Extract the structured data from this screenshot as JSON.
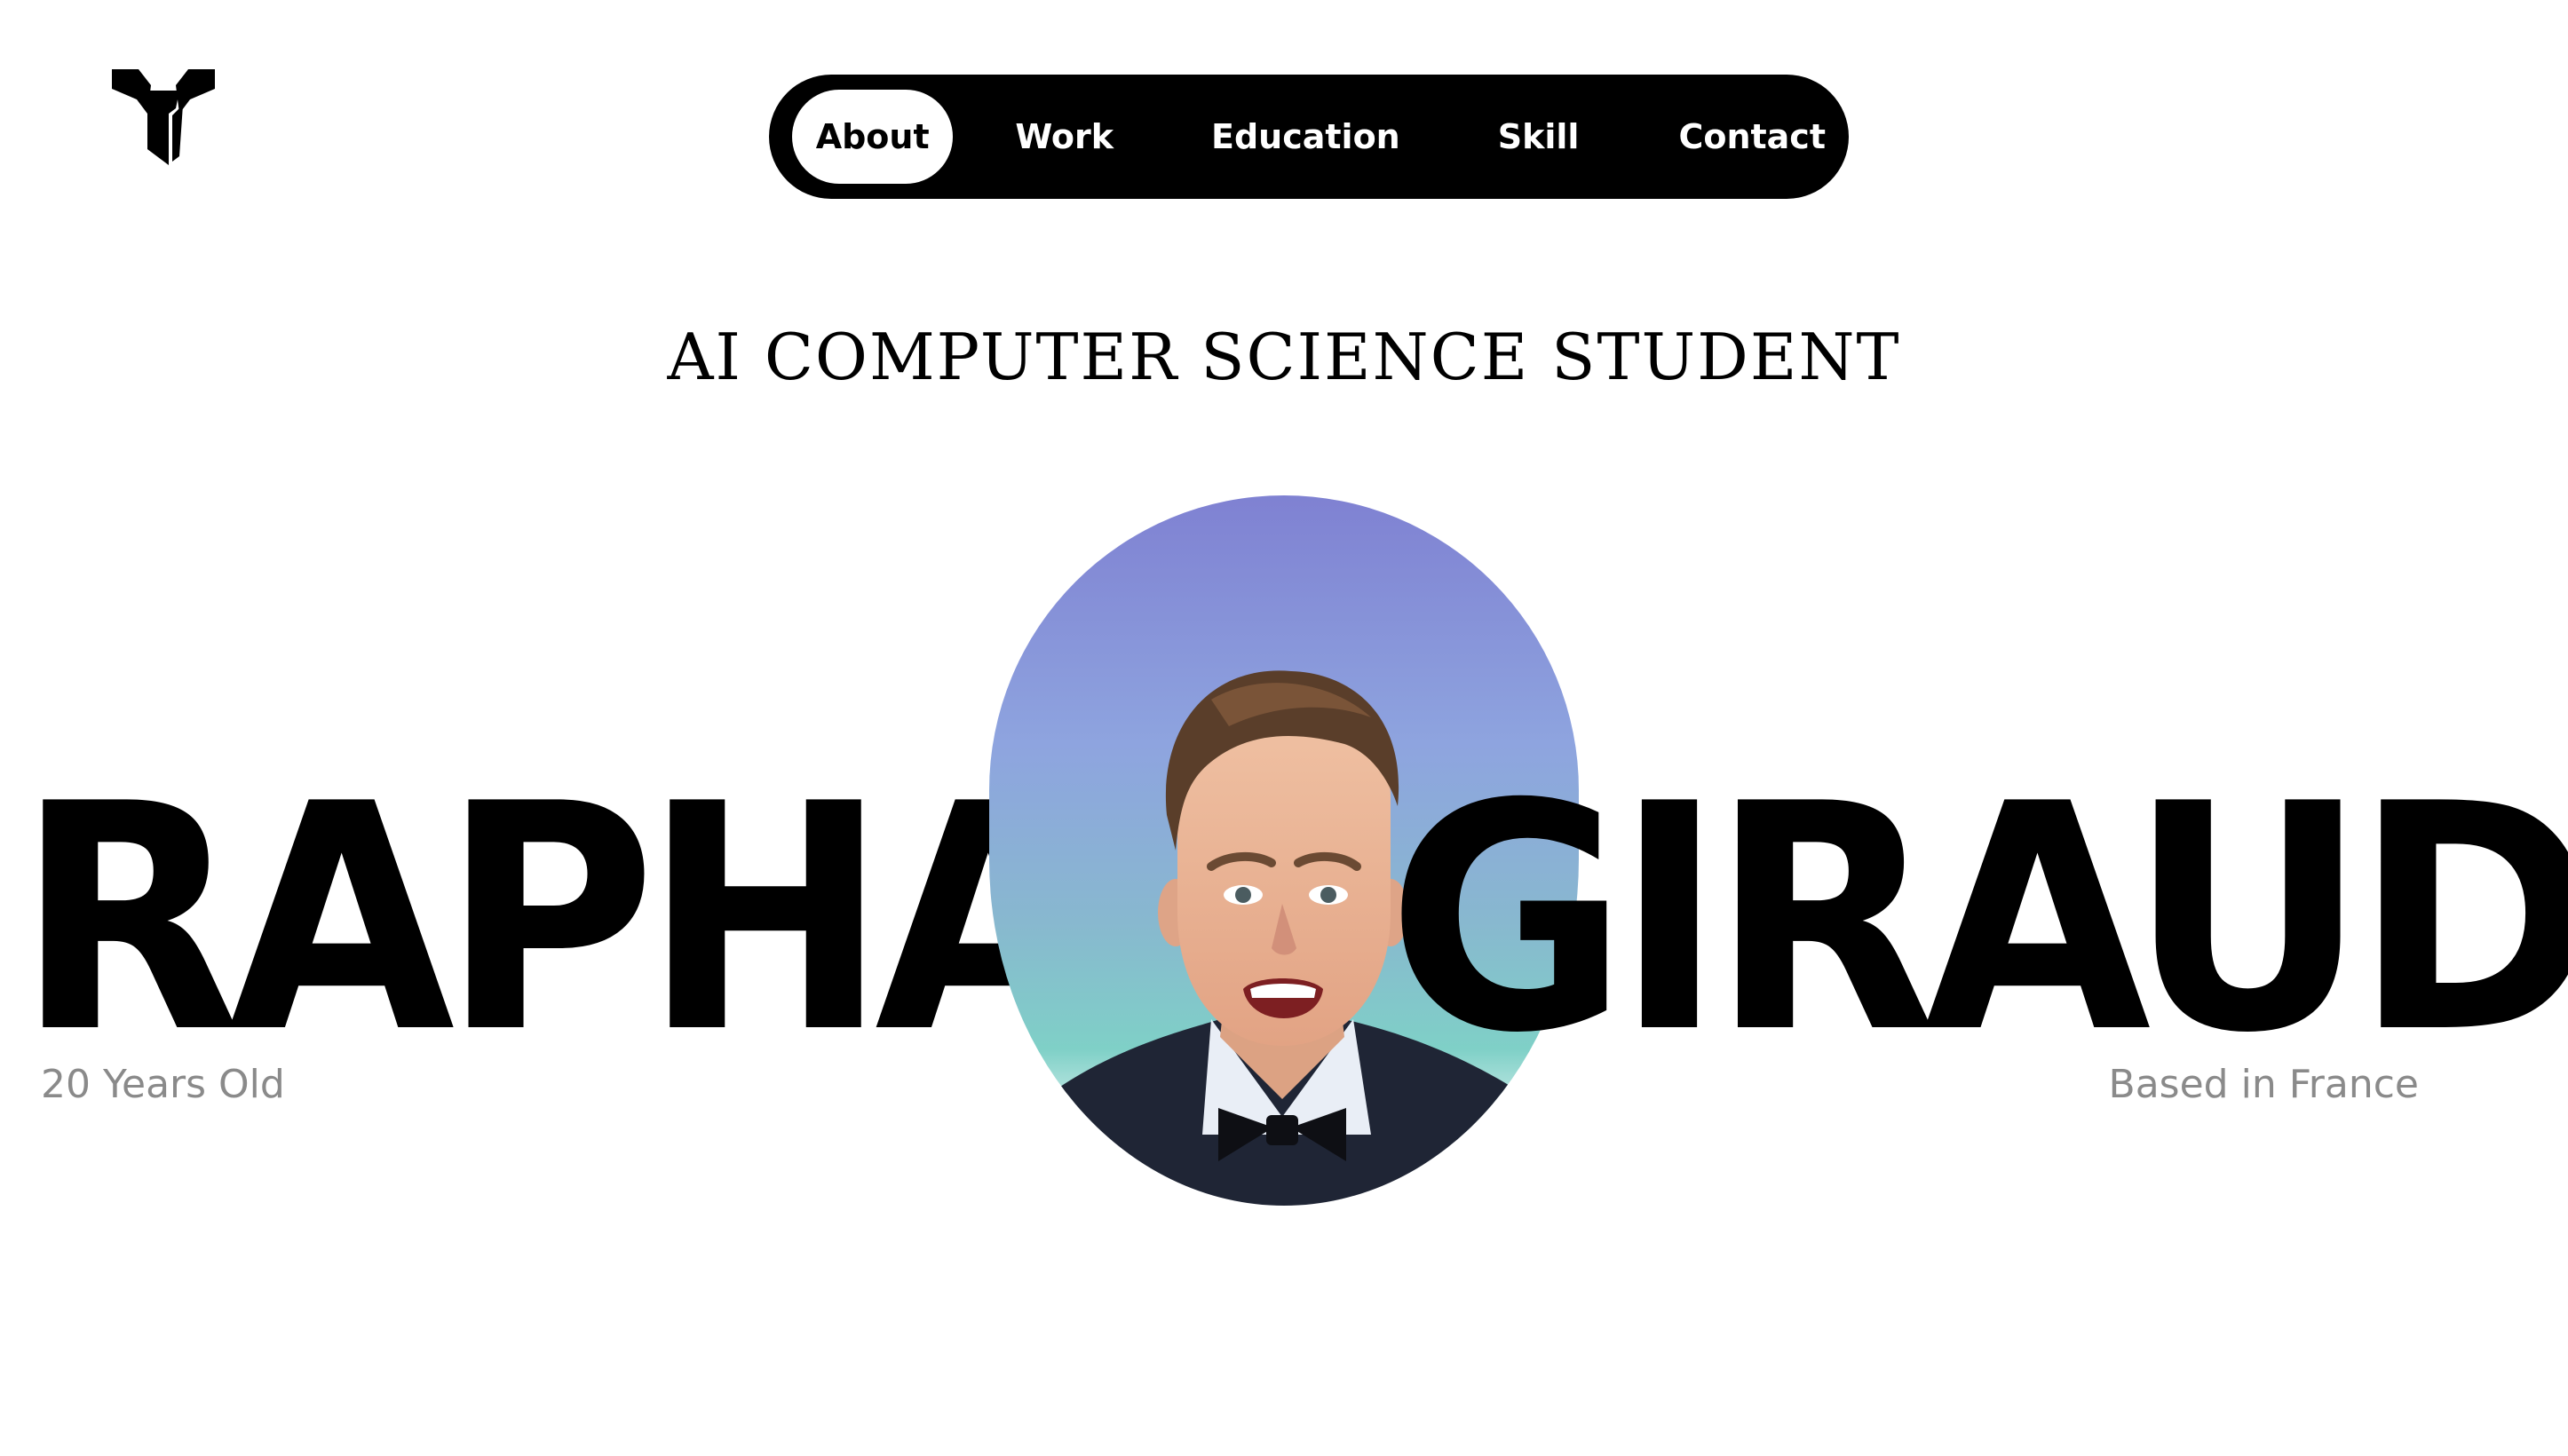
{
  "nav": {
    "items": [
      {
        "label": "About",
        "active": true
      },
      {
        "label": "Work"
      },
      {
        "label": "Education"
      },
      {
        "label": "Skill"
      },
      {
        "label": "Contact"
      }
    ]
  },
  "hero": {
    "subtitle": "AI COMPUTER SCIENCE STUDENT",
    "first_name": "RAPHAEL",
    "last_name": "GIRAUD",
    "age": "20 Years Old",
    "location": "Based in France"
  },
  "icons": {
    "logo": "logo-icon"
  },
  "colors": {
    "nav_background": "#000000",
    "active_pill": "#ffffff",
    "text": "#000000",
    "caption": "#8a8a8a",
    "portrait_gradient_top": "#7f81d2",
    "portrait_gradient_mid": "#8fb0da",
    "portrait_gradient_bottom": "#7ed0c8"
  }
}
